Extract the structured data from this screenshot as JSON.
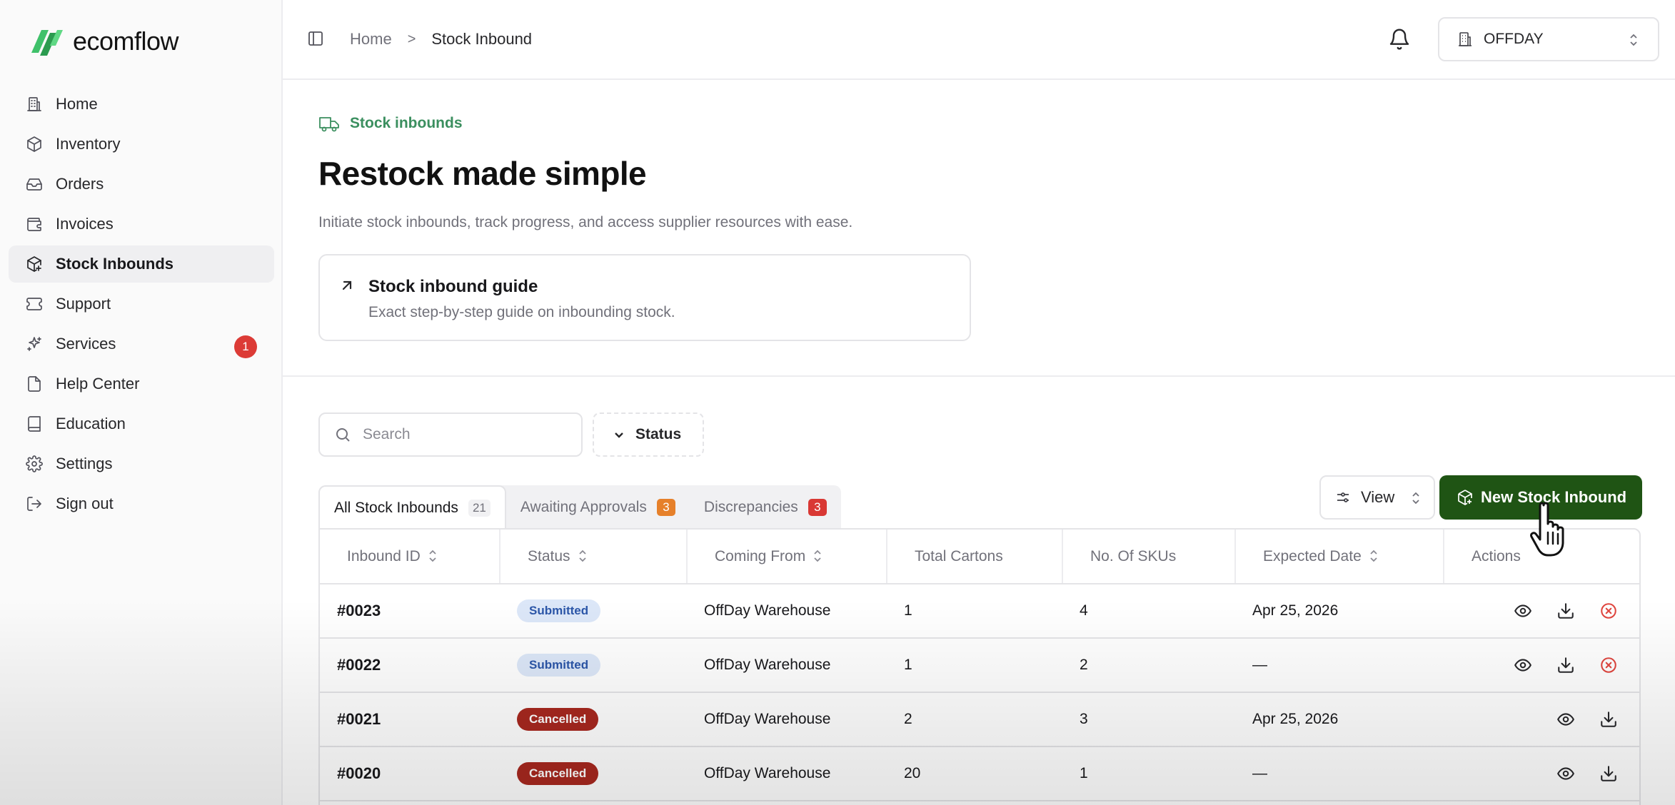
{
  "app": {
    "brand": "ecomflow"
  },
  "sidebar": {
    "items": [
      {
        "label": "Home",
        "icon": "building-icon"
      },
      {
        "label": "Inventory",
        "icon": "box-icon"
      },
      {
        "label": "Orders",
        "icon": "inbox-icon"
      },
      {
        "label": "Invoices",
        "icon": "wallet-icon"
      },
      {
        "label": "Stock Inbounds",
        "icon": "package-plus-icon",
        "active": true
      },
      {
        "label": "Support",
        "icon": "ticket-icon"
      },
      {
        "label": "Services",
        "icon": "sparkles-icon",
        "badge": "1"
      },
      {
        "label": "Help Center",
        "icon": "file-icon"
      },
      {
        "label": "Education",
        "icon": "book-icon"
      },
      {
        "label": "Settings",
        "icon": "gear-icon"
      },
      {
        "label": "Sign out",
        "icon": "sign-out-icon"
      }
    ]
  },
  "topbar": {
    "breadcrumb": {
      "home": "Home",
      "separator": ">",
      "current": "Stock Inbound"
    },
    "store": "OFFDAY"
  },
  "hero": {
    "eyebrow": "Stock inbounds",
    "title": "Restock made simple",
    "subtitle": "Initiate stock inbounds, track progress, and access supplier resources with ease."
  },
  "guide": {
    "title": "Stock inbound guide",
    "description": "Exact step-by-step guide on inbounding stock."
  },
  "filters": {
    "search_placeholder": "Search",
    "status_label": "Status"
  },
  "tabs": [
    {
      "label": "All Stock Inbounds",
      "count": "21",
      "active": true
    },
    {
      "label": "Awaiting Approvals",
      "count": "3",
      "color": "#e6802a"
    },
    {
      "label": "Discrepancies",
      "count": "3",
      "color": "#d93834"
    }
  ],
  "toolbar": {
    "view_label": "View",
    "new_label": "New Stock Inbound"
  },
  "table": {
    "columns": [
      "Inbound ID",
      "Status",
      "Coming From",
      "Total Cartons",
      "No. Of SKUs",
      "Expected Date",
      "Actions"
    ],
    "rows": [
      {
        "id": "#0023",
        "status": "Submitted",
        "from": "OffDay Warehouse",
        "cartons": "1",
        "skus": "4",
        "date": "Apr 25, 2026"
      },
      {
        "id": "#0022",
        "status": "Submitted",
        "from": "OffDay Warehouse",
        "cartons": "1",
        "skus": "2",
        "date": "—"
      },
      {
        "id": "#0021",
        "status": "Cancelled",
        "from": "OffDay Warehouse",
        "cartons": "2",
        "skus": "3",
        "date": "Apr 25, 2026"
      },
      {
        "id": "#0020",
        "status": "Cancelled",
        "from": "OffDay Warehouse",
        "cartons": "20",
        "skus": "1",
        "date": "—"
      }
    ]
  },
  "colors": {
    "brand_green": "#1f5414",
    "accent_green": "#3b8f5f",
    "badge_red": "#dc3b36",
    "submitted_bg": "#dce7f8",
    "cancelled_bg": "#a8281f"
  }
}
